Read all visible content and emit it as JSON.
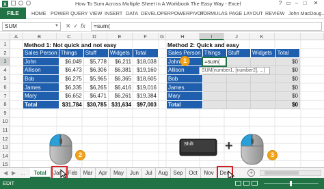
{
  "window": {
    "title": "How To Sum Across Multiple Sheet In A Workbook The Easy Way - Excel"
  },
  "ribbon": {
    "file": "FILE",
    "tabs": [
      "HOME",
      "POWER QUERY",
      "VIEW",
      "INSERT",
      "DATA",
      "DEVELOPER",
      "POWERPIVOT",
      "FORMULAS",
      "PAGE LAYOUT",
      "REVIEW"
    ],
    "user": "John MacDoug..."
  },
  "formula_bar": {
    "name_box": "SUM",
    "cancel": "✕",
    "enter": "✓",
    "fx": "fx",
    "formula": "=sum("
  },
  "grid": {
    "columns": [
      "A",
      "B",
      "C",
      "D",
      "E",
      "F",
      "G",
      "H",
      "I",
      "J",
      "K"
    ],
    "selected_column": "I",
    "rows": [
      "1",
      "2",
      "3",
      "4",
      "5",
      "6",
      "7",
      "8",
      "9",
      "10",
      "11",
      "12",
      "13",
      "14",
      "15",
      "16",
      "17",
      "18"
    ],
    "selected_row": "3"
  },
  "table1": {
    "title": "Method 1: Not quick and not easy",
    "headers": [
      "Sales Person",
      "Things",
      "Stuff",
      "Widgets",
      "Total"
    ],
    "rows": [
      [
        "John",
        "$6,049",
        "$5,778",
        "$6,211",
        "$18,038"
      ],
      [
        "Allison",
        "$6,473",
        "$6,306",
        "$6,381",
        "$19,160"
      ],
      [
        "Bob",
        "$6,275",
        "$5,965",
        "$6,365",
        "$18,605"
      ],
      [
        "James",
        "$6,335",
        "$6,265",
        "$6,416",
        "$19,016"
      ],
      [
        "Mary",
        "$6,652",
        "$6,471",
        "$6,261",
        "$19,384"
      ]
    ],
    "total": [
      "Total",
      "$31,784",
      "$30,785",
      "$31,634",
      "$97,003"
    ]
  },
  "table2": {
    "title": "Method 2: Quick and easy",
    "headers": [
      "Sales Person",
      "Things",
      "Stuff",
      "Widgets",
      "Total"
    ],
    "active_cell": "=sum(",
    "rows": [
      [
        "John",
        "",
        "",
        "",
        "$0"
      ],
      [
        "Allison",
        "",
        "",
        "",
        "$0"
      ],
      [
        "Bob",
        "",
        "",
        "",
        "$0"
      ],
      [
        "James",
        "",
        "",
        "",
        "$0"
      ],
      [
        "Mary",
        "",
        "",
        "",
        "$0"
      ]
    ],
    "total": [
      "Total",
      "",
      "",
      "",
      "$0"
    ]
  },
  "tooltip": "SUM(number1, [number2], ...)",
  "badges": [
    "1",
    "2",
    "3"
  ],
  "shift_key": "Shift",
  "plus_sign": "+",
  "sheet_tabs": [
    "Total",
    "Jan",
    "Feb",
    "Mar",
    "Apr",
    "May",
    "Jun",
    "Jul",
    "Aug",
    "Sep",
    "Oct",
    "Nov",
    "Dec"
  ],
  "active_sheet": "Total",
  "sheet_nav_more": "...",
  "add_sheet": "+",
  "status": {
    "mode": "EDIT"
  },
  "colors": {
    "excel_green": "#217346",
    "table_blue": "#1f5fad",
    "highlight_red": "#d81e1e",
    "badge_orange": "#f2a41d"
  }
}
